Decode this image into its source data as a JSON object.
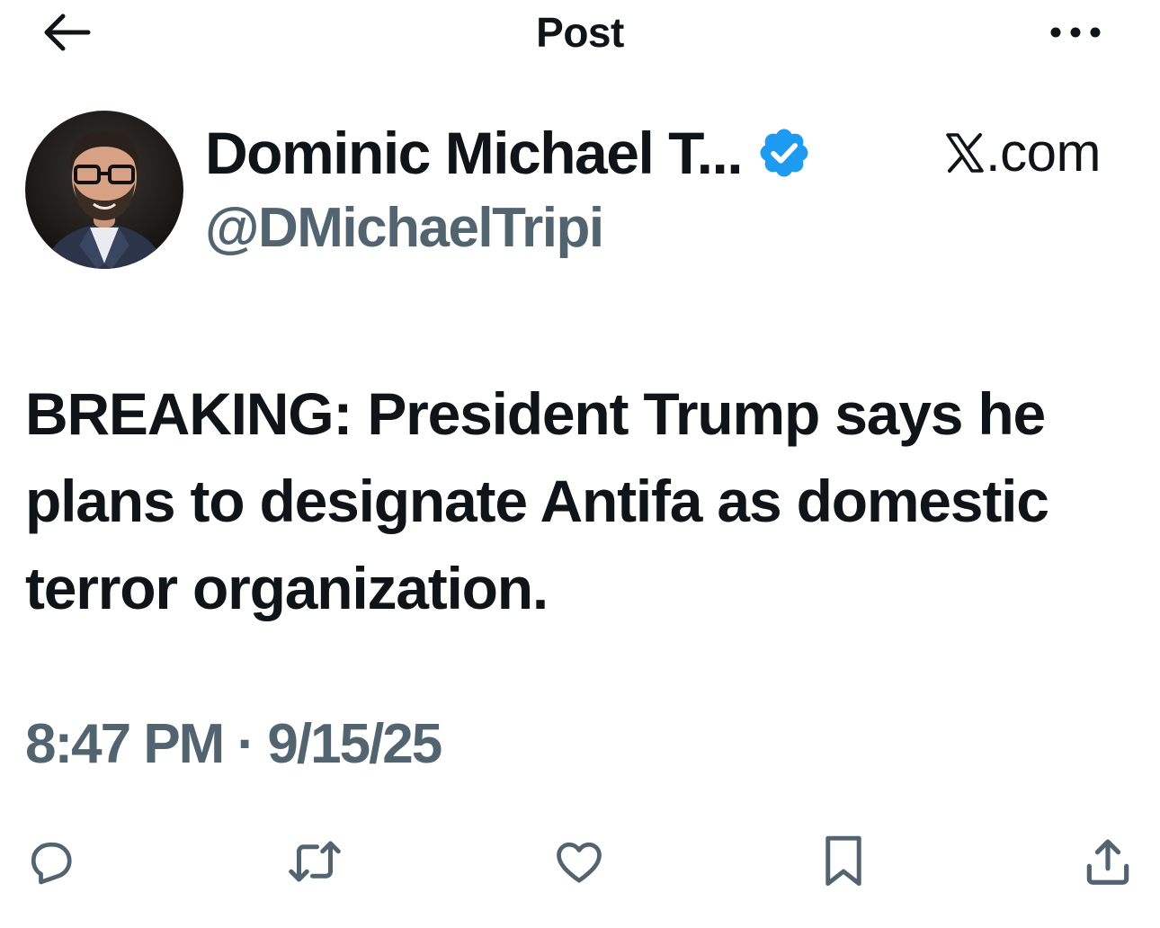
{
  "header": {
    "title": "Post",
    "back_icon": "arrow-left-icon",
    "more_icon": "more-horizontal-icon"
  },
  "author": {
    "display_name": "Dominic Michael T...",
    "handle": "@DMichaelTripi",
    "verified": true,
    "verified_color": "#1d9bf0"
  },
  "source": {
    "logo": "X",
    "label": ".com"
  },
  "tweet": {
    "text": "BREAKING: President Trump says he plans to designate Antifa as domestic terror organization.",
    "timestamp": "8:47 PM · 9/15/25"
  },
  "actions": [
    {
      "name": "reply",
      "icon": "reply-icon"
    },
    {
      "name": "repost",
      "icon": "repost-icon"
    },
    {
      "name": "like",
      "icon": "heart-icon"
    },
    {
      "name": "bookmark",
      "icon": "bookmark-icon"
    },
    {
      "name": "share",
      "icon": "share-icon"
    }
  ],
  "colors": {
    "text": "#0f1419",
    "secondary": "#536471",
    "accent": "#1d9bf0",
    "background": "#ffffff"
  }
}
